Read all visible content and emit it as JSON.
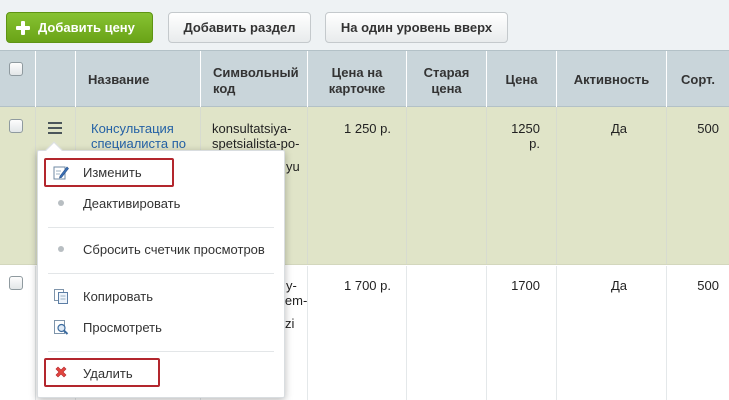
{
  "toolbar": {
    "add_price": "Добавить цену",
    "add_section": "Добавить раздел",
    "level_up": "На один уровень вверх"
  },
  "columns": {
    "name": "Название",
    "code_l1": "Символьный",
    "code_l2": "код",
    "card_price_l1": "Цена на",
    "card_price_l2": "карточке",
    "old_price_l1": "Старая",
    "old_price_l2": "цена",
    "price": "Цена",
    "active": "Активность",
    "sort": "Сорт."
  },
  "rows": [
    {
      "name_l1": "Консультация",
      "name_l2": "специалиста по",
      "code_l1": "konsultatsiya-",
      "code_l2": "spetsialista-po-",
      "code_l3": "yu",
      "card_price": "1 250 р.",
      "price_l1": "1250",
      "price_l2": "р.",
      "active": "Да",
      "sort": "500"
    },
    {
      "code_l1": "y-",
      "code_l2": "iem-",
      "code_l3": "zi",
      "card_price": "1 700 р.",
      "price": "1700",
      "active": "Да",
      "sort": "500"
    }
  ],
  "context_menu": {
    "edit": "Изменить",
    "deactivate": "Деактивировать",
    "reset_views": "Сбросить счетчик просмотров",
    "copy": "Копировать",
    "view": "Просмотреть",
    "delete": "Удалить"
  },
  "colors": {
    "primary_button": "#6aa317",
    "selected_row": "#e0e4c8",
    "header_bg": "#c9d5da",
    "link": "#2461a5",
    "highlight_border": "#b3262d"
  },
  "icons": {
    "add": "plus-icon",
    "row_actions": "hamburger-menu-icon",
    "edit": "pencil-edit-icon",
    "copy": "copy-documents-icon",
    "view": "magnifier-view-icon",
    "delete": "red-x-delete-icon"
  }
}
